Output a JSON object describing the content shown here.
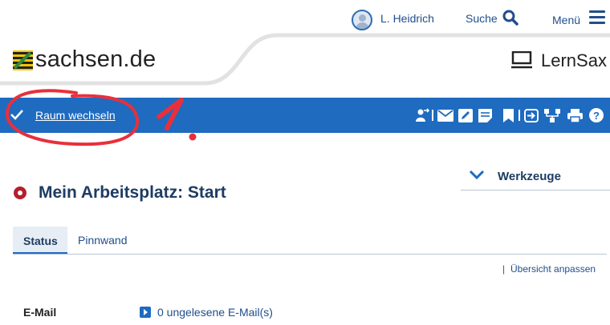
{
  "topbar": {
    "user_name": "L. Heidrich",
    "search_label": "Suche",
    "menu_label": "Menü"
  },
  "header": {
    "site_name": "sachsen.de",
    "app_name": "LernSax"
  },
  "toolbar": {
    "room_switch_label": "Raum wechseln",
    "icons": [
      "user-switch-icon",
      "mail-icon",
      "edit-icon",
      "notes-icon",
      "bookmark-icon",
      "login-icon",
      "tree-icon",
      "print-icon",
      "help-icon"
    ]
  },
  "annotation": {
    "number": "1."
  },
  "tools_panel": {
    "label": "Werkzeuge"
  },
  "page": {
    "title": "Mein Arbeitsplatz: Start"
  },
  "tabs": [
    {
      "label": "Status",
      "active": true
    },
    {
      "label": "Pinnwand",
      "active": false
    }
  ],
  "overview": {
    "separator": "|",
    "link_label": "Übersicht anpassen"
  },
  "status_rows": [
    {
      "label": "E-Mail",
      "value": "0 ungelesene E-Mail(s)"
    }
  ],
  "colors": {
    "brand_blue": "#1e6bc0",
    "title_blue": "#1d3c63",
    "accent_red": "#b41f2d",
    "annotation_red": "#e8303c"
  }
}
